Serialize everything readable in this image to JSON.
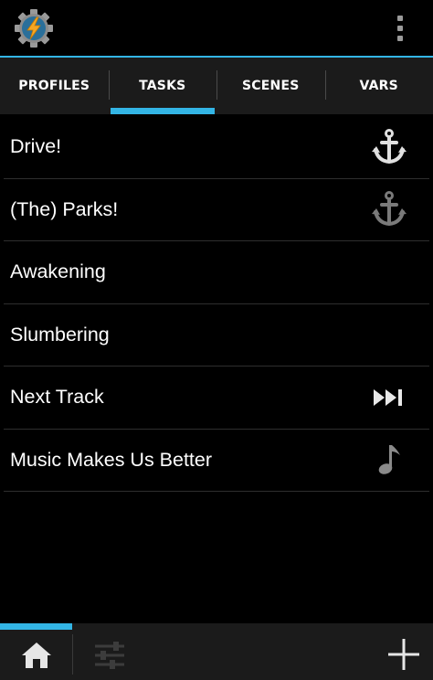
{
  "app": {
    "icon": "tasker-app-icon",
    "overflow_icon": "overflow-menu-icon"
  },
  "tabs": [
    {
      "label": "PROFILES",
      "active": false
    },
    {
      "label": "TASKS",
      "active": true
    },
    {
      "label": "SCENES",
      "active": false
    },
    {
      "label": "VARS",
      "active": false
    }
  ],
  "tasks": [
    {
      "label": "Drive!",
      "icon": "anchor-icon"
    },
    {
      "label": "(The) Parks!",
      "icon": "anchor-icon"
    },
    {
      "label": "Awakening",
      "icon": ""
    },
    {
      "label": "Slumbering",
      "icon": ""
    },
    {
      "label": "Next Track",
      "icon": "skip-next-icon"
    },
    {
      "label": "Music Makes Us Better",
      "icon": "music-note-icon"
    }
  ],
  "bottom_bar": {
    "home_icon": "home-icon",
    "filter_icon": "sliders-icon",
    "add_icon": "add-icon"
  },
  "colors": {
    "accent": "#33b5e5",
    "background": "#000000",
    "bar": "#1b1b1b"
  }
}
